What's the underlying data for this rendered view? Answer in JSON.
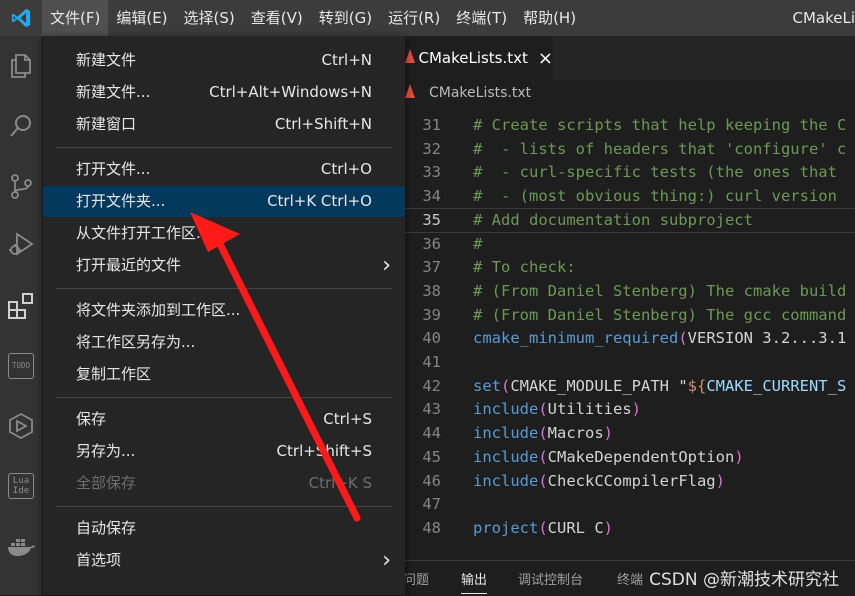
{
  "window_title": "CMakeLists.txt - ...",
  "menubar": {
    "items": [
      "文件(F)",
      "编辑(E)",
      "选择(S)",
      "查看(V)",
      "转到(G)",
      "运行(R)",
      "终端(T)",
      "帮助(H)"
    ],
    "title": "CMakeLi"
  },
  "activity_icons": [
    "files-icon",
    "search-icon",
    "source-control-icon",
    "run-debug-icon",
    "extensions-icon",
    "todo-icon",
    "cube-icon",
    "lua-ide-icon",
    "docker-icon"
  ],
  "activity_text": {
    "todo": "TODO",
    "lua": "Lua\nIde"
  },
  "editor": {
    "tab_label": "CMakeLists.txt",
    "tab_close": "×",
    "breadcrumb": "CMakeLists.txt",
    "code_lines": [
      {
        "n": "31",
        "parts": [
          [
            "c",
            "# Create scripts that help keeping the C"
          ]
        ]
      },
      {
        "n": "32",
        "parts": [
          [
            "c",
            "#  - lists of headers that 'configure' c"
          ]
        ]
      },
      {
        "n": "33",
        "parts": [
          [
            "c",
            "#  - curl-specific tests (the ones that "
          ]
        ]
      },
      {
        "n": "34",
        "parts": [
          [
            "c",
            "#  - (most obvious thing:) curl version "
          ]
        ]
      },
      {
        "n": "35",
        "parts": [
          [
            "c",
            "# Add documentation subproject"
          ]
        ],
        "current": true
      },
      {
        "n": "36",
        "parts": [
          [
            "c",
            "#"
          ]
        ]
      },
      {
        "n": "37",
        "parts": [
          [
            "c",
            "# To check:"
          ]
        ]
      },
      {
        "n": "38",
        "parts": [
          [
            "c",
            "# (From Daniel Stenberg) The cmake build"
          ]
        ]
      },
      {
        "n": "39",
        "parts": [
          [
            "c",
            "# (From Daniel Stenberg) The gcc command"
          ]
        ]
      },
      {
        "n": "40",
        "parts": [
          [
            "f",
            "cmake_minimum_required"
          ],
          [
            "p",
            "("
          ],
          [
            "t",
            "VERSION 3.2...3.1"
          ]
        ]
      },
      {
        "n": "41",
        "parts": []
      },
      {
        "n": "42",
        "parts": [
          [
            "f",
            "set"
          ],
          [
            "p",
            "("
          ],
          [
            "t",
            "CMAKE_MODULE_PATH \""
          ],
          [
            "s",
            "${"
          ],
          [
            "v",
            "CMAKE_CURRENT_S"
          ]
        ]
      },
      {
        "n": "43",
        "parts": [
          [
            "f",
            "include"
          ],
          [
            "p",
            "("
          ],
          [
            "t",
            "Utilities"
          ],
          [
            "p",
            ")"
          ]
        ]
      },
      {
        "n": "44",
        "parts": [
          [
            "f",
            "include"
          ],
          [
            "p",
            "("
          ],
          [
            "t",
            "Macros"
          ],
          [
            "p",
            ")"
          ]
        ]
      },
      {
        "n": "45",
        "parts": [
          [
            "f",
            "include"
          ],
          [
            "p",
            "("
          ],
          [
            "t",
            "CMakeDependentOption"
          ],
          [
            "p",
            ")"
          ]
        ]
      },
      {
        "n": "46",
        "parts": [
          [
            "f",
            "include"
          ],
          [
            "p",
            "("
          ],
          [
            "t",
            "CheckCCompilerFlag"
          ],
          [
            "p",
            ")"
          ]
        ]
      },
      {
        "n": "47",
        "parts": []
      },
      {
        "n": "48",
        "parts": [
          [
            "f",
            "project"
          ],
          [
            "p",
            "("
          ],
          [
            "t",
            "CURL C"
          ],
          [
            "p",
            ")"
          ]
        ]
      }
    ]
  },
  "file_menu": {
    "groups": [
      [
        {
          "label": "新建文件",
          "key": "Ctrl+N"
        },
        {
          "label": "新建文件...",
          "key": "Ctrl+Alt+Windows+N"
        },
        {
          "label": "新建窗口",
          "key": "Ctrl+Shift+N"
        }
      ],
      [
        {
          "label": "打开文件...",
          "key": "Ctrl+O"
        },
        {
          "label": "打开文件夹...",
          "key": "Ctrl+K Ctrl+O",
          "hover": true
        },
        {
          "label": "从文件打开工作区...",
          "key": ""
        },
        {
          "label": "打开最近的文件",
          "key": "",
          "submenu": true
        }
      ],
      [
        {
          "label": "将文件夹添加到工作区...",
          "key": ""
        },
        {
          "label": "将工作区另存为...",
          "key": ""
        },
        {
          "label": "复制工作区",
          "key": ""
        }
      ],
      [
        {
          "label": "保存",
          "key": "Ctrl+S"
        },
        {
          "label": "另存为...",
          "key": "Ctrl+Shift+S"
        },
        {
          "label": "全部保存",
          "key": "Ctrl+K S",
          "disabled": true
        }
      ],
      [
        {
          "label": "自动保存",
          "key": ""
        },
        {
          "label": "首选项",
          "key": "",
          "submenu": true
        }
      ]
    ],
    "submenu_glyph": "›"
  },
  "panel": {
    "tabs": [
      "问题",
      "输出",
      "调试控制台",
      "终端"
    ],
    "active": "输出"
  },
  "watermark": "CSDN @新潮技术研究社",
  "colors": {
    "accent_hover": "#04395e",
    "annotation_arrow": "#ff1a1a"
  }
}
